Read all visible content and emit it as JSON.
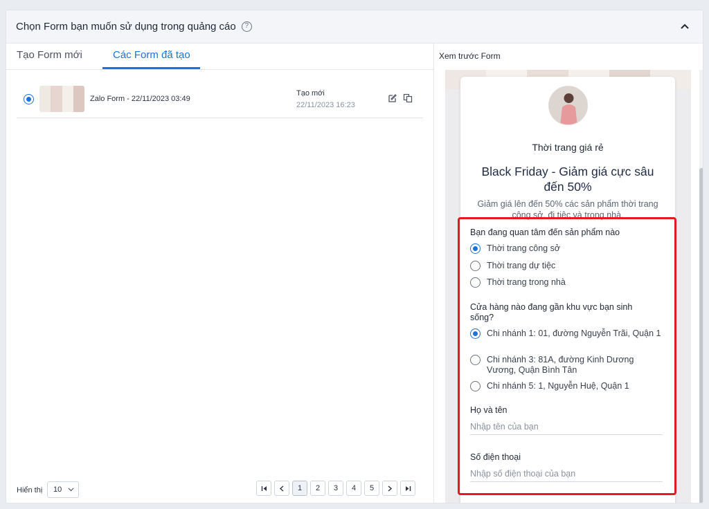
{
  "header": {
    "title": "Chọn Form bạn muốn sử dụng trong quảng cáo"
  },
  "tabs": {
    "new_form": "Tạo Form mới",
    "created_forms": "Các Form đã tạo"
  },
  "form_list": [
    {
      "name": "Zalo Form - 22/11/2023 03:49",
      "status": "Tạo mới",
      "date": "22/11/2023 16:23",
      "selected": true
    }
  ],
  "footer": {
    "page_size_label": "Hiển thị",
    "page_size_value": "10"
  },
  "pagination": {
    "pages": [
      "1",
      "2",
      "3",
      "4",
      "5"
    ],
    "current": "1"
  },
  "preview": {
    "title": "Xem trước Form",
    "brand": "Thời trang giá rẻ",
    "headline": "Black Friday - Giảm giá cực sâu đến 50%",
    "description": "Giảm giá lên đến 50% các sản phẩm thời trang công sở, đi tiệc và trong nhà.",
    "questions": [
      {
        "text": "Bạn đang quan tâm đến sản phẩm nào",
        "options": [
          "Thời trang công sở",
          "Thời trang dự tiệc",
          "Thời trang trong nhà"
        ],
        "selected": 0
      },
      {
        "text": "Cửa hàng nào đang gần khu vực bạn sinh sống?",
        "options": [
          "Chi nhánh 1: 01, đường Nguyễn Trãi, Quận 1",
          "Chi nhánh 3: 81A, đường Kinh Dương Vương, Quận Bình Tân",
          "Chi nhánh 5: 1, Nguyễn Huệ, Quận 1"
        ],
        "selected": 0
      }
    ],
    "fields": [
      {
        "label": "Họ và tên",
        "placeholder": "Nhập tên của bạn"
      },
      {
        "label": "Số điện thoại",
        "placeholder": "Nhập số điện thoại của bạn"
      }
    ]
  },
  "colors": {
    "accent": "#1a73d9",
    "highlight_border": "#e11a23"
  }
}
